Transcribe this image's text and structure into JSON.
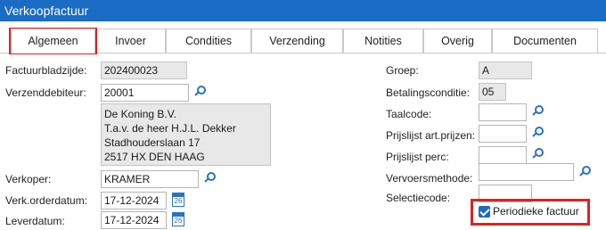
{
  "window": {
    "title": "Verkoopfactuur"
  },
  "tabs": [
    {
      "label": "Algemeen",
      "active": true
    },
    {
      "label": "Invoer"
    },
    {
      "label": "Condities"
    },
    {
      "label": "Verzending"
    },
    {
      "label": "Notities"
    },
    {
      "label": "Overig"
    },
    {
      "label": "Documenten"
    }
  ],
  "left": {
    "factuurbladzijde": {
      "label": "Factuurbladzijde:",
      "value": "202400023"
    },
    "verzenddebiteur": {
      "label": "Verzenddebiteur:",
      "value": "20001"
    },
    "address": [
      "De Koning B.V.",
      "T.a.v. de heer H.J.L. Dekker",
      "Stadhouderslaan 17",
      "2517 HX DEN HAAG"
    ],
    "verkoper": {
      "label": "Verkoper:",
      "value": "KRAMER"
    },
    "orderdatum": {
      "label": "Verk.orderdatum:",
      "value": "17-12-2024"
    },
    "leverdatum": {
      "label": "Leverdatum:",
      "value": "17-12-2024"
    }
  },
  "right": {
    "groep": {
      "label": "Groep:",
      "value": "A"
    },
    "betalingsconditie": {
      "label": "Betalingsconditie:",
      "value": "05"
    },
    "taalcode": {
      "label": "Taalcode:",
      "value": ""
    },
    "prijslijst_art": {
      "label": "Prijslijst art.prijzen:",
      "value": ""
    },
    "prijslijst_perc": {
      "label": "Prijslijst perc:",
      "value": ""
    },
    "vervoersmethode": {
      "label": "Vervoersmethode:",
      "value": ""
    },
    "selectiecode": {
      "label": "Selectiecode:",
      "value": ""
    },
    "periodieke": {
      "label": "Periodieke factuur",
      "checked": true
    }
  },
  "icons": {
    "lookup": "magnifier-icon",
    "calendar": "calendar-icon",
    "calendar_text": "26"
  },
  "colors": {
    "titlebar": "#1a6cc4",
    "accent": "#2a72c4",
    "highlight": "#e02222"
  }
}
